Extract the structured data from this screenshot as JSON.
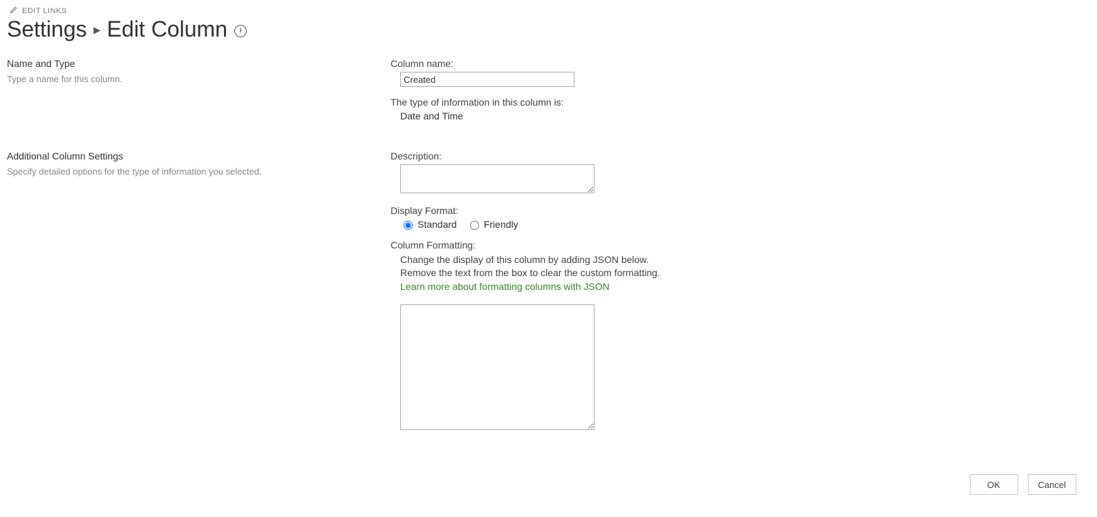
{
  "topLink": {
    "label": "EDIT LINKS"
  },
  "breadcrumb": {
    "parent": "Settings",
    "separator": "▸",
    "current": "Edit Column",
    "infoGlyph": "ⓘ"
  },
  "section1": {
    "title": "Name and Type",
    "blurb": "Type a name for this column.",
    "columnNameLabel": "Column name:",
    "columnNameValue": "Created",
    "typeLabel": "The type of information in this column is:",
    "typeValue": "Date and Time"
  },
  "section2": {
    "title": "Additional Column Settings",
    "blurb": "Specify detailed options for the type of information you selected.",
    "descriptionLabel": "Description:",
    "descriptionValue": "",
    "displayFormatLabel": "Display Format:",
    "radioStandard": "Standard",
    "radioFriendly": "Friendly",
    "columnFormattingLabel": "Column Formatting:",
    "columnFormattingHelp1": "Change the display of this column by adding JSON below.",
    "columnFormattingHelp2": "Remove the text from the box to clear the custom formatting.",
    "learnMoreLink": "Learn more about formatting columns with JSON",
    "jsonValue": ""
  },
  "buttons": {
    "ok": "OK",
    "cancel": "Cancel"
  }
}
